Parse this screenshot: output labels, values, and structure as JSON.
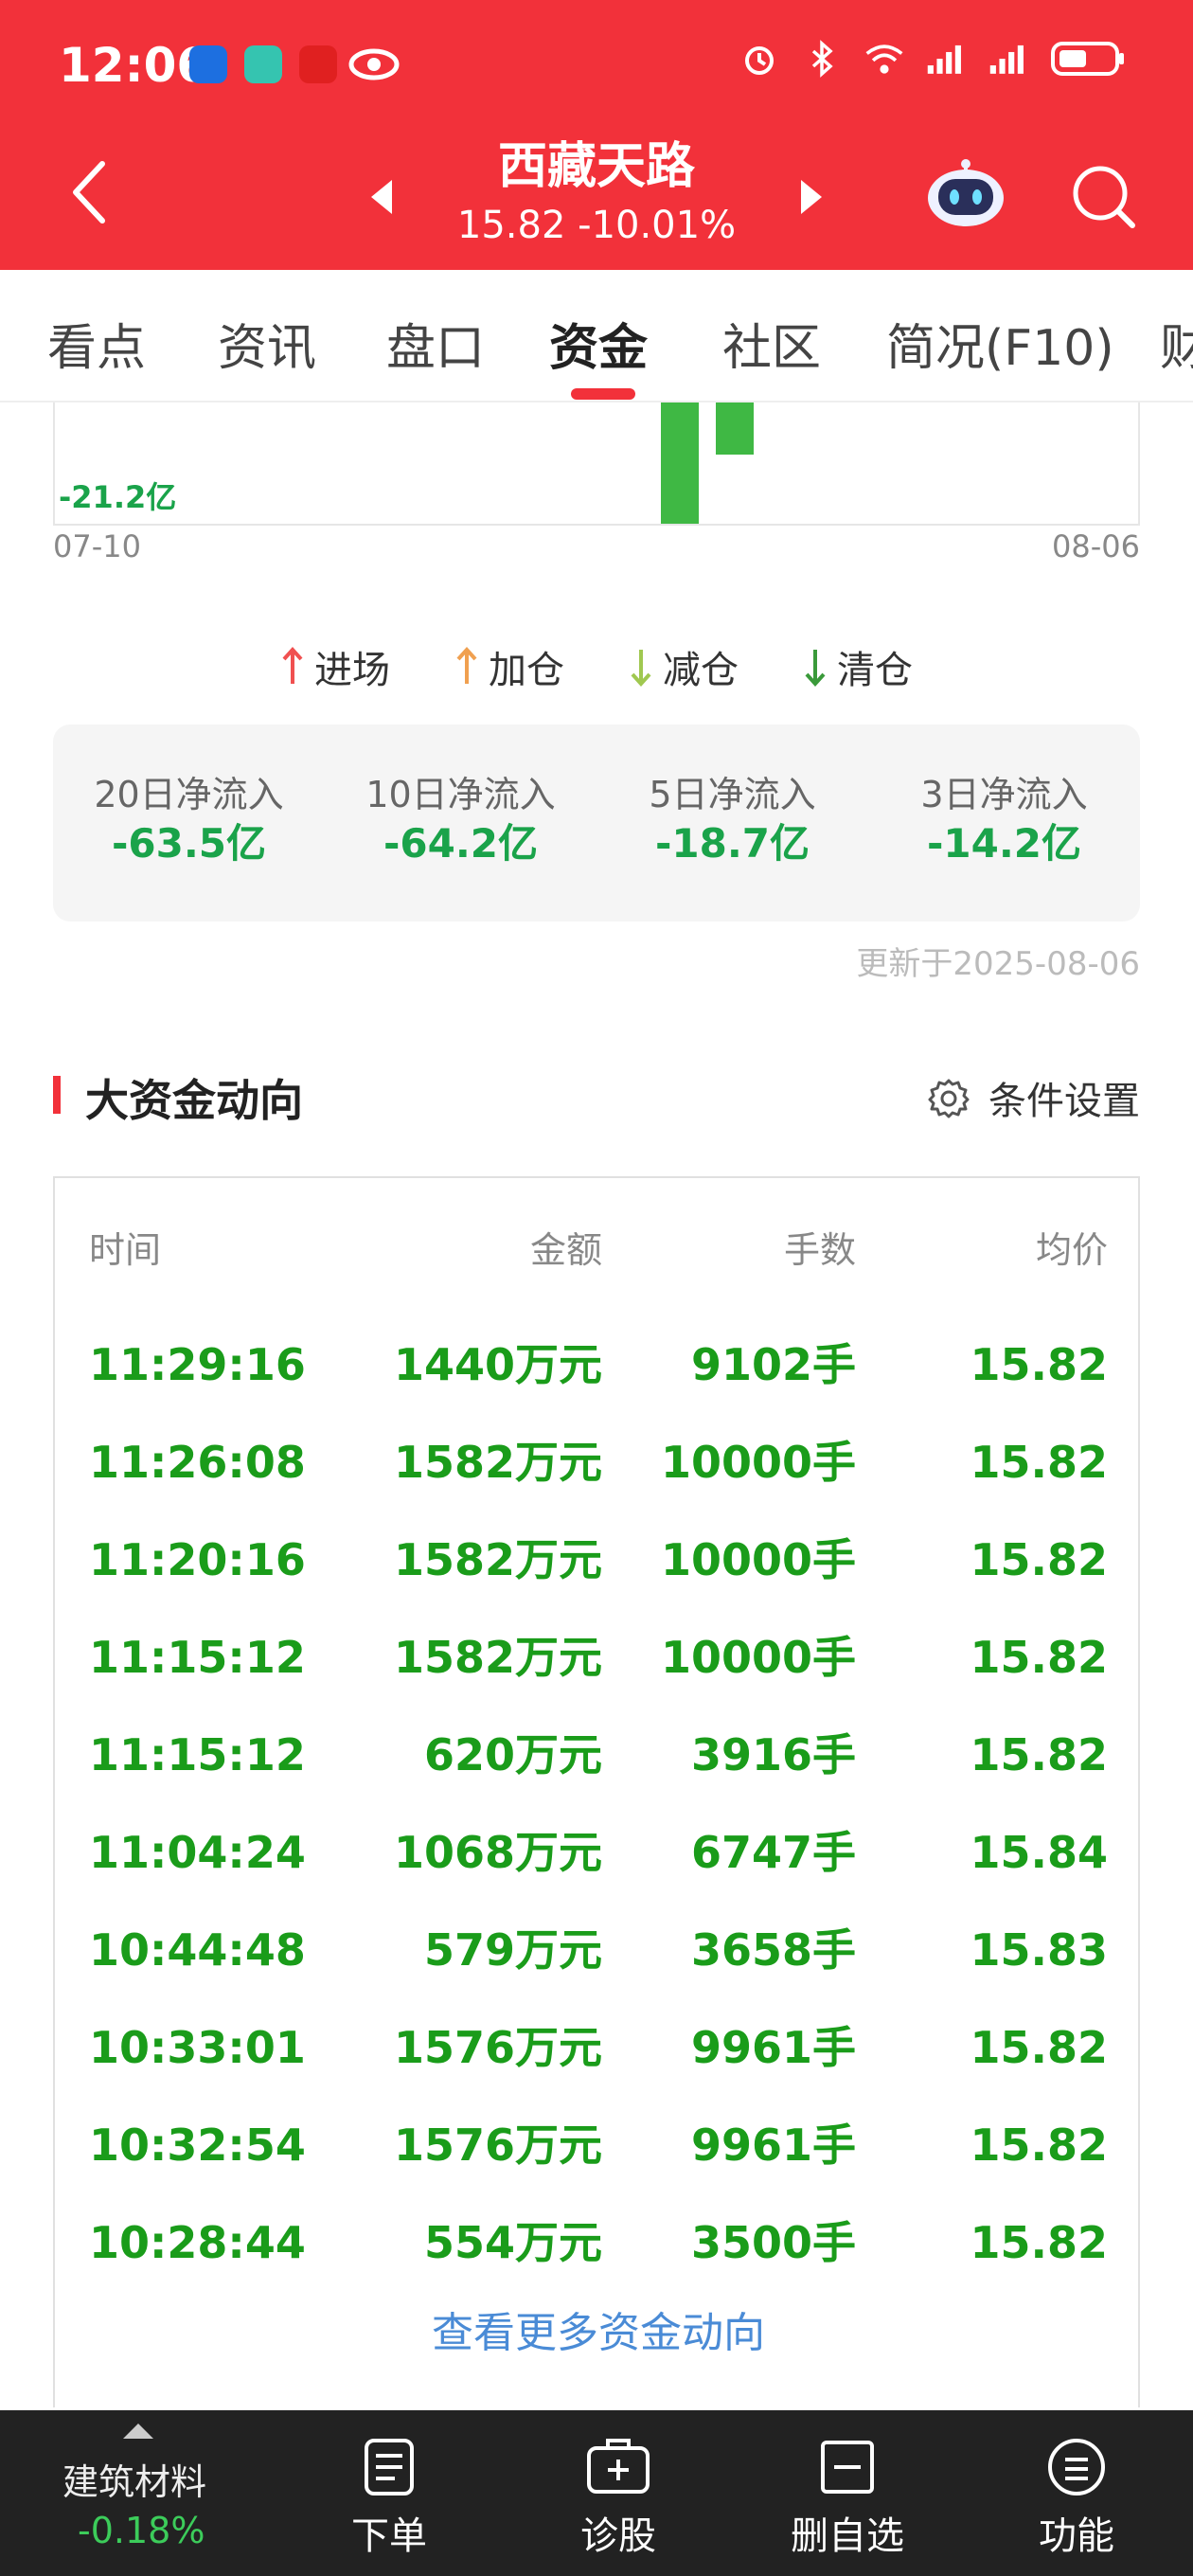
{
  "status_bar": {
    "time": "12:06"
  },
  "header": {
    "stock_name": "西藏天路",
    "quote": "15.82  -10.01%"
  },
  "tabs": [
    {
      "label": "看点",
      "active": false
    },
    {
      "label": "资讯",
      "active": false
    },
    {
      "label": "盘口",
      "active": false
    },
    {
      "label": "资金",
      "active": true
    },
    {
      "label": "社区",
      "active": false
    },
    {
      "label": "简况(F10)",
      "active": false
    },
    {
      "label": "财",
      "active": false
    }
  ],
  "chart": {
    "min_label": "-21.2亿",
    "x_start": "07-10",
    "x_end": "08-06"
  },
  "legend": [
    {
      "label": "进场",
      "icon": "arrow-up-icon",
      "color": "#f05050"
    },
    {
      "label": "加仓",
      "icon": "arrow-up-icon",
      "color": "#f0a050"
    },
    {
      "label": "减仓",
      "icon": "arrow-down-icon",
      "color": "#a0c850"
    },
    {
      "label": "清仓",
      "icon": "arrow-down-icon",
      "color": "#3a9a3a"
    }
  ],
  "net_flow": [
    {
      "label": "20日净流入",
      "value": "-63.5亿"
    },
    {
      "label": "10日净流入",
      "value": "-64.2亿"
    },
    {
      "label": "5日净流入",
      "value": "-18.7亿"
    },
    {
      "label": "3日净流入",
      "value": "-14.2亿"
    }
  ],
  "updated": "更新于2025-08-06",
  "section": {
    "title": "大资金动向",
    "settings_label": "条件设置"
  },
  "table": {
    "headers": [
      "时间",
      "金额",
      "手数",
      "均价"
    ],
    "rows": [
      [
        "11:29:16",
        "1440万元",
        "9102手",
        "15.82"
      ],
      [
        "11:26:08",
        "1582万元",
        "10000手",
        "15.82"
      ],
      [
        "11:20:16",
        "1582万元",
        "10000手",
        "15.82"
      ],
      [
        "11:15:12",
        "1582万元",
        "10000手",
        "15.82"
      ],
      [
        "11:15:12",
        "620万元",
        "3916手",
        "15.82"
      ],
      [
        "11:04:24",
        "1068万元",
        "6747手",
        "15.84"
      ],
      [
        "10:44:48",
        "579万元",
        "3658手",
        "15.83"
      ],
      [
        "10:33:01",
        "1576万元",
        "9961手",
        "15.82"
      ],
      [
        "10:32:54",
        "1576万元",
        "9961手",
        "15.82"
      ],
      [
        "10:28:44",
        "554万元",
        "3500手",
        "15.82"
      ]
    ],
    "more_label": "查看更多资金动向"
  },
  "bottom_bar": {
    "sector_name": "建筑材料",
    "sector_change": "-0.18%",
    "items": [
      {
        "label": "下单",
        "icon": "order-icon"
      },
      {
        "label": "诊股",
        "icon": "diagnose-icon"
      },
      {
        "label": "删自选",
        "icon": "remove-watchlist-icon"
      },
      {
        "label": "功能",
        "icon": "menu-icon"
      }
    ]
  },
  "colors": {
    "brand_red": "#f2313a",
    "down_green": "#1a9c1a",
    "link_blue": "#4a8bd6"
  }
}
